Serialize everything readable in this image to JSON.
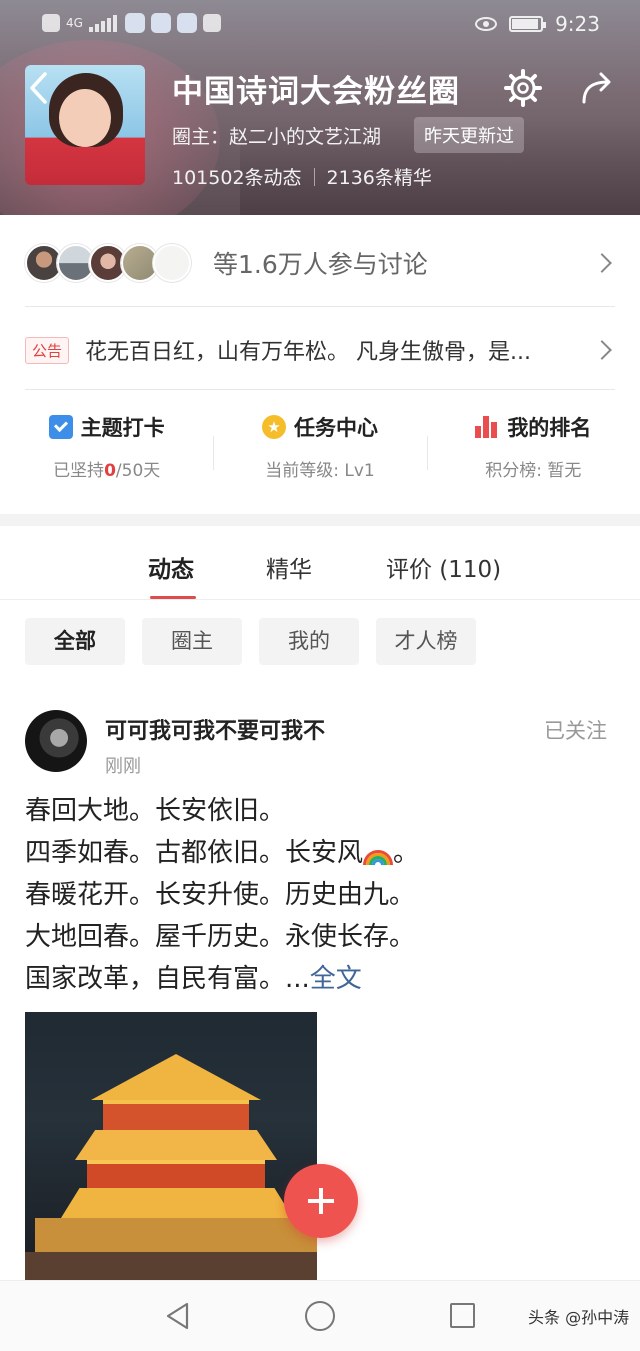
{
  "status_bar": {
    "time": "9:23",
    "network": "4G"
  },
  "header": {
    "title": "中国诗词大会粉丝圈",
    "owner": "圈主：赵二小的文艺江湖",
    "update_badge": "昨天更新过",
    "posts_count": "101502条动态",
    "featured_count": "2136条精华"
  },
  "participants": {
    "text": "等1.6万人参与讨论"
  },
  "notice": {
    "tag": "公告",
    "text": "花无百日红，山有万年松。 凡身生傲骨，是..."
  },
  "actions": [
    {
      "title": "主题打卡",
      "sub_prefix": "已坚持",
      "sub_value": "0",
      "sub_suffix": "/50天",
      "icon": "calendar-check-icon"
    },
    {
      "title": "任务中心",
      "sub": "当前等级: Lv1",
      "icon": "star-badge-icon"
    },
    {
      "title": "我的排名",
      "sub": "积分榜: 暂无",
      "icon": "bar-chart-icon"
    }
  ],
  "tabs": [
    {
      "label": "动态",
      "active": true
    },
    {
      "label": "精华",
      "active": false
    },
    {
      "label": "评价 (110)",
      "active": false
    }
  ],
  "filters": [
    {
      "label": "全部",
      "active": true
    },
    {
      "label": "圈主",
      "active": false
    },
    {
      "label": "我的",
      "active": false
    },
    {
      "label": "才人榜",
      "active": false
    }
  ],
  "post": {
    "username": "可可我可我不要可我不",
    "time": "刚刚",
    "follow_status": "已关注",
    "lines": [
      "春回大地。长安依旧。",
      "四季如春。古都依旧。长安风",
      "春暖花开。长安升使。历史由九。",
      "大地回春。屋千历史。永使长存。",
      "国家改革，自民有富。..."
    ],
    "line2_suffix": "。",
    "more_label": "全文"
  },
  "watermark": "头条 @孙中涛",
  "colors": {
    "accent_red": "#e04b4b",
    "fab": "#ef5350",
    "link": "#406599"
  }
}
